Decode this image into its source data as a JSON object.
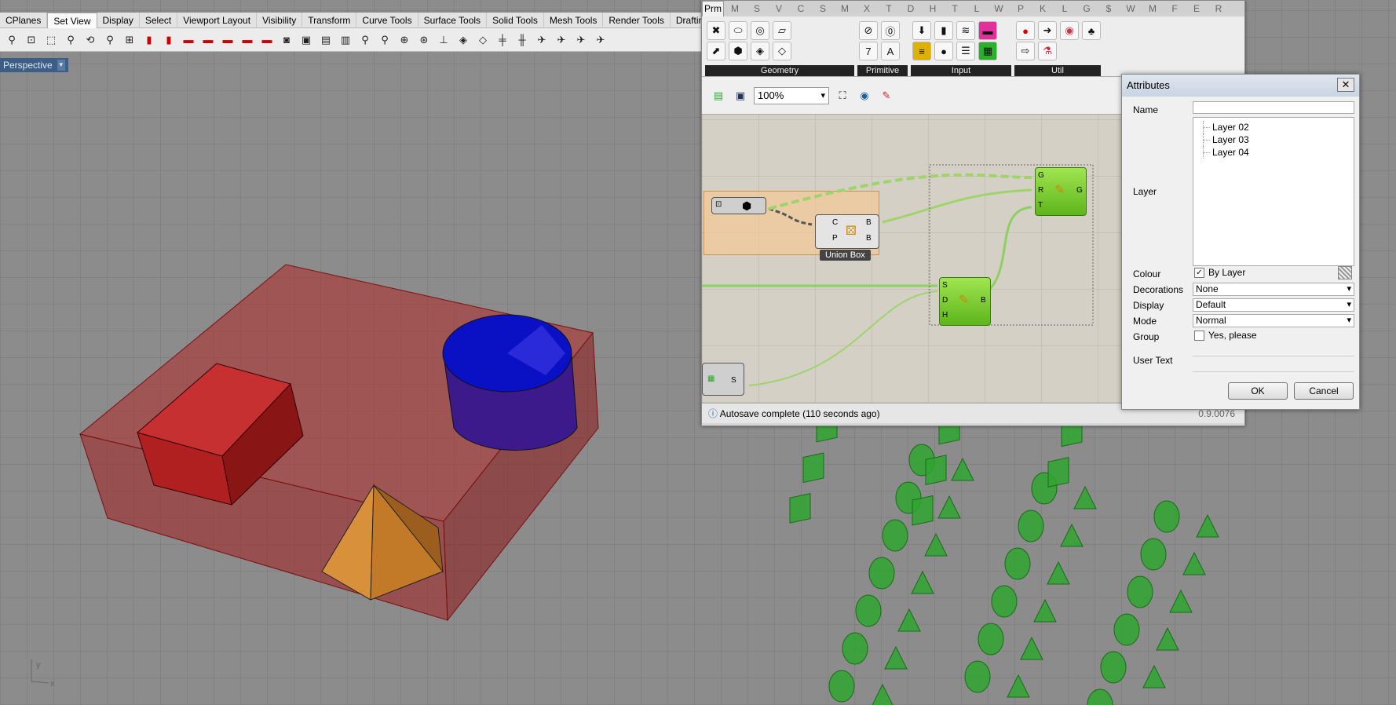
{
  "rhino": {
    "tabs": [
      "CPlanes",
      "Set View",
      "Display",
      "Select",
      "Viewport Layout",
      "Visibility",
      "Transform",
      "Curve Tools",
      "Surface Tools",
      "Solid Tools",
      "Mesh Tools",
      "Render Tools",
      "Drafting"
    ],
    "active_tab": "Set View",
    "viewport_label": "Perspective",
    "axis_labels": {
      "x": "x",
      "y": "y"
    }
  },
  "gh": {
    "tabs": [
      "Prm",
      "M",
      "S",
      "V",
      "C",
      "S",
      "M",
      "X",
      "T",
      "D",
      "H",
      "T",
      "L",
      "W",
      "P",
      "K",
      "L",
      "G",
      "$",
      "W",
      "M",
      "F",
      "E",
      "R"
    ],
    "ribbon_groups": [
      "Geometry",
      "Primitive",
      "Input",
      "Util"
    ],
    "zoom": "100%",
    "status": "Autosave complete (110 seconds ago)",
    "version": "0.9.0076",
    "canvas": {
      "union_label": "Union Box",
      "union_inputs": [
        "C",
        "P"
      ],
      "union_outputs": [
        "B",
        "B"
      ],
      "bake_inputs": [
        "G",
        "R",
        "T"
      ],
      "bake_output": "G",
      "second_inputs": [
        "S",
        "D",
        "H"
      ],
      "second_output": "B",
      "left_output": "S"
    }
  },
  "attr": {
    "title": "Attributes",
    "labels": {
      "name": "Name",
      "layer": "Layer",
      "colour": "Colour",
      "decorations": "Decorations",
      "display": "Display",
      "mode": "Mode",
      "group": "Group",
      "user_text": "User Text"
    },
    "layers": [
      "Layer 02",
      "Layer 03",
      "Layer 04"
    ],
    "colour_value": "By Layer",
    "decorations_value": "None",
    "display_value": "Default",
    "mode_value": "Normal",
    "group_value": "Yes, please",
    "ok": "OK",
    "cancel": "Cancel"
  },
  "colors": {
    "box": "#b03030",
    "cylinder": "#0000b5",
    "pyramid": "#d9862f",
    "green": "#2fa52f"
  }
}
